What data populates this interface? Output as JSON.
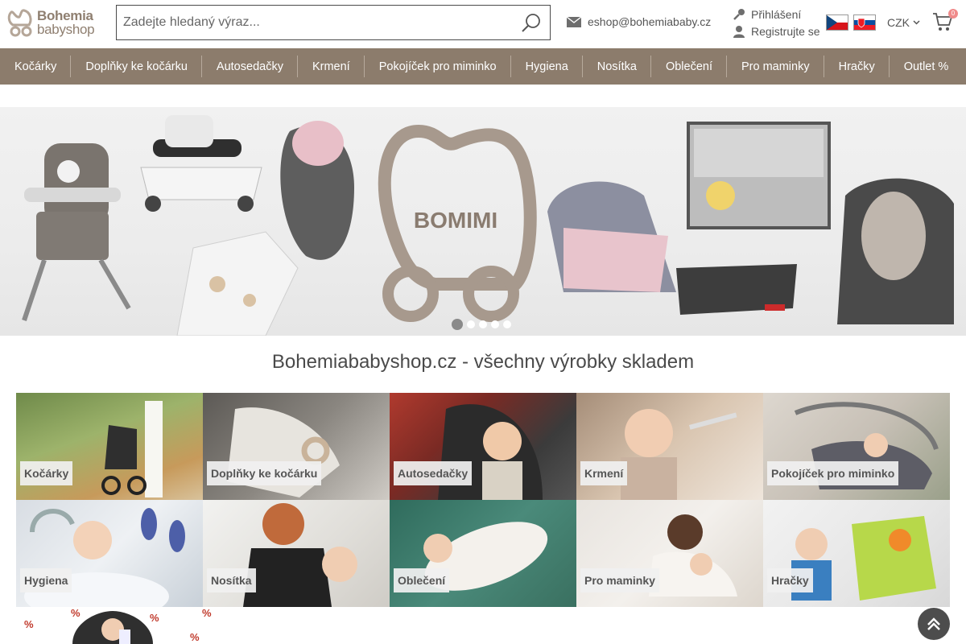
{
  "header": {
    "logo_line1": "Bohemia",
    "logo_line2": "babyshop",
    "search_placeholder": "Zadejte hledaný výraz...",
    "email": "eshop@bohemiababy.cz",
    "login": "Přihlášení",
    "register": "Registrujte se",
    "currency": "CZK",
    "cart_count": "0"
  },
  "nav": {
    "items": [
      "Kočárky",
      "Doplňky ke kočárku",
      "Autosedačky",
      "Krmení",
      "Pokojíček pro miminko",
      "Hygiena",
      "Nosítka",
      "Oblečení",
      "Pro maminky",
      "Hračky",
      "Outlet %"
    ]
  },
  "banner": {
    "brand": "BOMIMI",
    "slide_count": 5,
    "active_slide": 1
  },
  "page_title": "Bohemiababyshop.cz - všechny výrobky skladem",
  "categories": [
    "Kočárky",
    "Doplňky ke kočárku",
    "Autosedačky",
    "Krmení",
    "Pokojíček pro miminko",
    "Hygiena",
    "Nosítka",
    "Oblečení",
    "Pro maminky",
    "Hračky"
  ],
  "outlet_mark": "%",
  "colors": {
    "nav_bg": "#8c7c6c",
    "brand_brown": "#8f7f70",
    "cart_badge": "#f08b8b",
    "outlet_red": "#c0392b"
  }
}
